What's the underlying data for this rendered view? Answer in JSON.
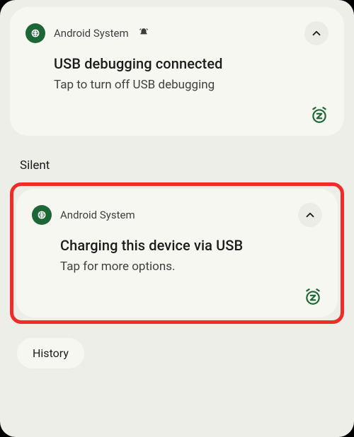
{
  "notifications": [
    {
      "app": "Android System",
      "show_bell": true,
      "title": "USB debugging connected",
      "body": "Tap to turn off USB debugging"
    },
    {
      "app": "Android System",
      "show_bell": false,
      "title": "Charging this device via USB",
      "body": "Tap for more options."
    }
  ],
  "section_label": "Silent",
  "history_label": "History",
  "colors": {
    "accent": "#1d6635",
    "highlight": "#ef2c29",
    "card": "#f7f7f2",
    "shade": "#eeeee9"
  }
}
